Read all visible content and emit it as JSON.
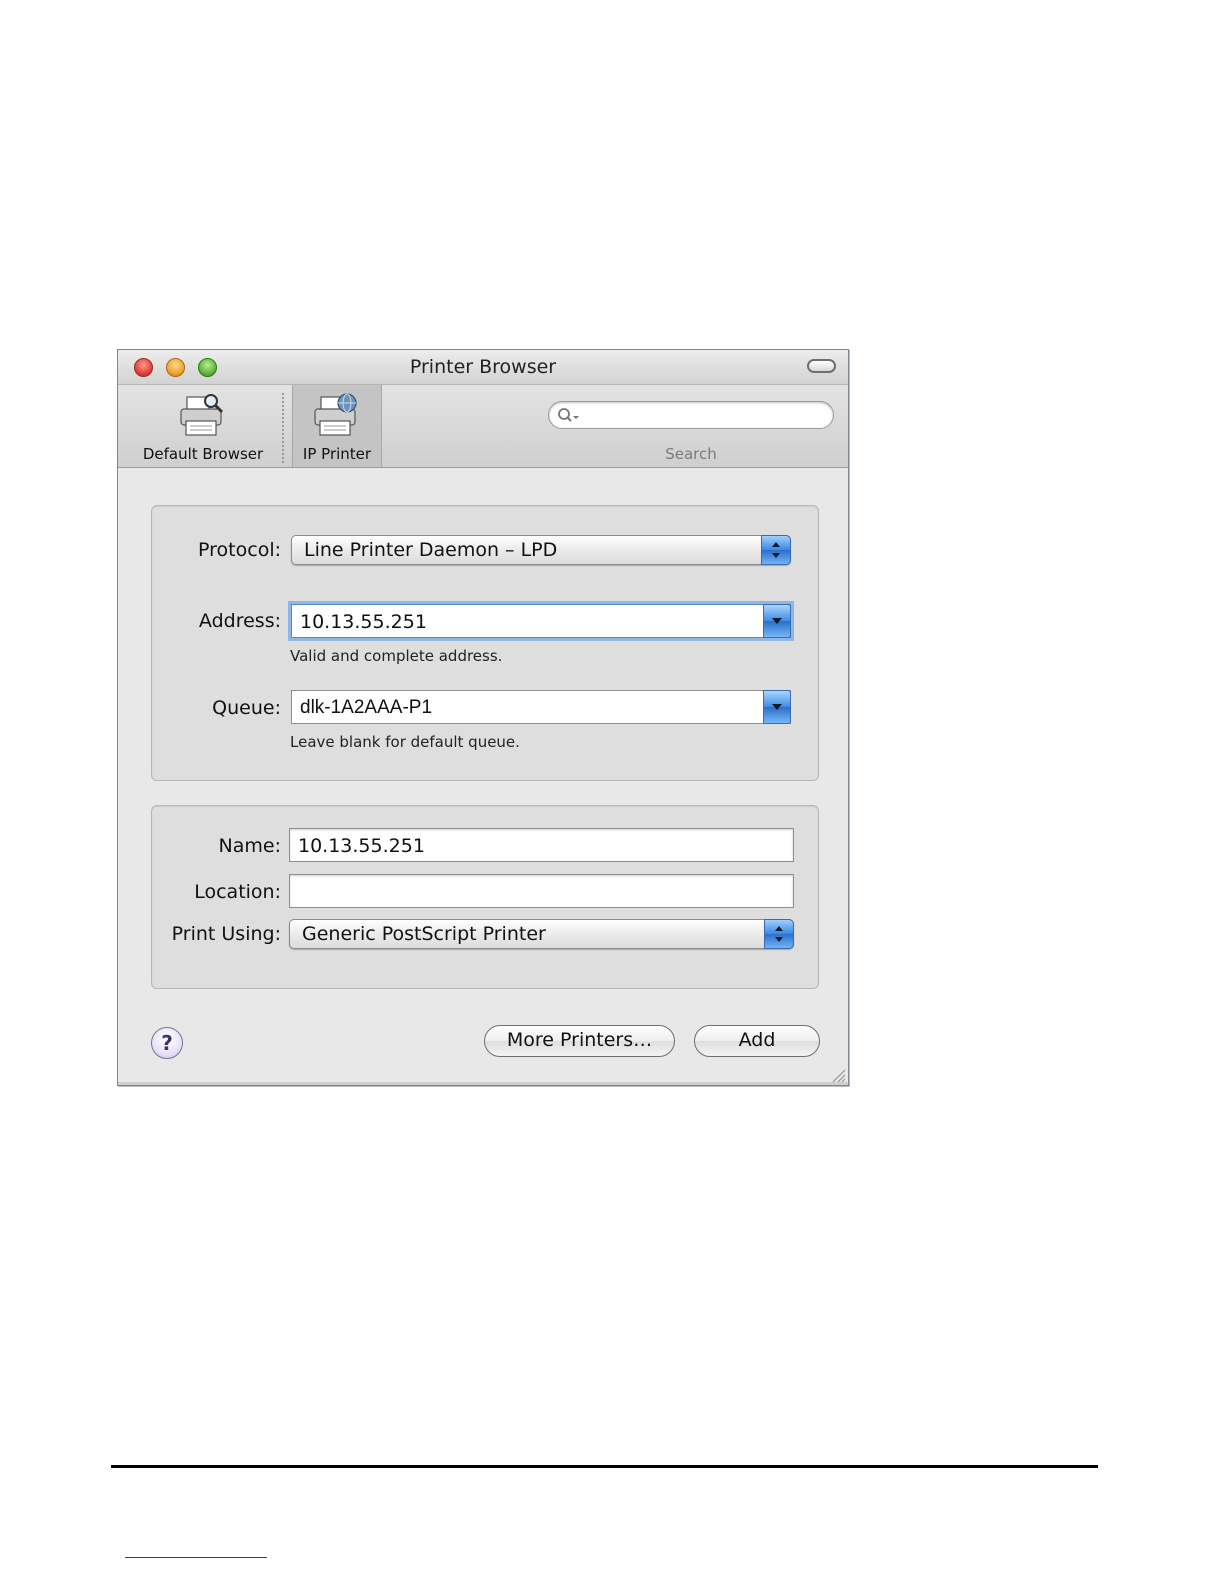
{
  "window": {
    "title": "Printer Browser"
  },
  "toolbar": {
    "items": [
      {
        "label": "Default Browser",
        "icon": "printer-magnifier-icon"
      },
      {
        "label": "IP Printer",
        "icon": "printer-globe-icon",
        "selected": true
      }
    ],
    "search": {
      "label": "Search",
      "value": "",
      "placeholder": ""
    }
  },
  "form": {
    "protocol": {
      "label": "Protocol:",
      "value": "Line Printer Daemon – LPD"
    },
    "address": {
      "label": "Address:",
      "value": "10.13.55.251",
      "hint": "Valid and complete address."
    },
    "queue": {
      "label": "Queue:",
      "value": "dlk-1A2AAA-P1",
      "hint": "Leave blank for default queue."
    },
    "name": {
      "label": "Name:",
      "value": "10.13.55.251"
    },
    "location": {
      "label": "Location:",
      "value": ""
    },
    "print_using": {
      "label": "Print Using:",
      "value": "Generic PostScript Printer"
    }
  },
  "buttons": {
    "help": "?",
    "more_printers": "More Printers…",
    "add": "Add"
  },
  "colors": {
    "accent_blue": "#3a86e0",
    "focus_ring": "#8fb6e6",
    "close": "#e0443a",
    "minimize": "#f2a42a",
    "zoom": "#5dba3b"
  }
}
